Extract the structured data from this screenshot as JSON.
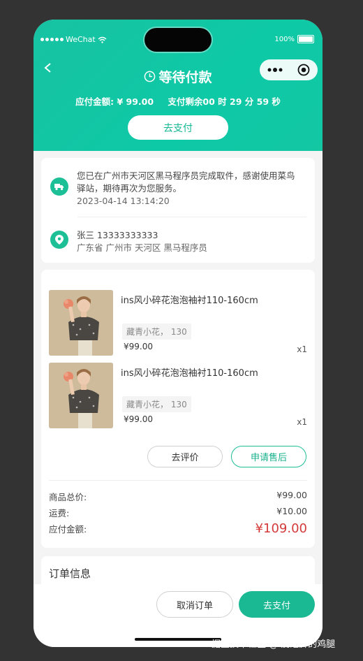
{
  "status": {
    "carrier": "WeChat",
    "battery": "100%"
  },
  "header": {
    "title": "等待付款",
    "amount_label": "应付金额: ¥ 99.00",
    "countdown_label": "支付剩余00 时 29 分 59 秒",
    "pay_button": "去支付"
  },
  "delivery": {
    "message": "您已在广州市天河区黑马程序员完成取件，感谢使用菜鸟驿站，期待再次为您服务。",
    "time": "2023-04-14 13:14:20"
  },
  "address": {
    "contact": "张三 13333333333",
    "detail": "广东省 广州市 天河区 黑马程序员"
  },
  "goods": [
    {
      "name": "ins风小碎花泡泡袖衬110-160cm",
      "spec": "藏青小花， 130",
      "price": "¥99.00",
      "qty": "x1"
    },
    {
      "name": "ins风小碎花泡泡袖衬110-160cm",
      "spec": "藏青小花， 130",
      "price": "¥99.00",
      "qty": "x1"
    }
  ],
  "actions": {
    "review": "去评价",
    "after_sale": "申请售后"
  },
  "summary": {
    "goods_total_label": "商品总价:",
    "goods_total": "¥99.00",
    "shipping_label": "运费:",
    "shipping": "¥10.00",
    "payable_label": "应付金额:",
    "payable": "¥109.00"
  },
  "order_info": {
    "title": "订单信息"
  },
  "bottom": {
    "cancel": "取消订单",
    "pay": "去支付"
  },
  "watermark": "掘金技术社区 @ 爱泡脚的鸡腿",
  "colors": {
    "primary": "#1ab993",
    "price_red": "#d33a3a"
  }
}
